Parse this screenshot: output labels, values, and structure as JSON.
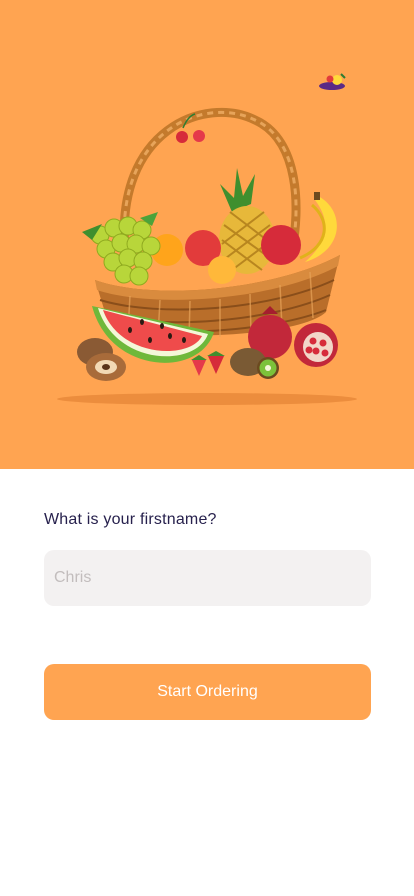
{
  "hero": {
    "image": "fruit-basket-illustration",
    "background_color": "#FFA451",
    "decoration": "small-fruit-icon"
  },
  "form": {
    "question": "What is your firstname?",
    "name_input": {
      "value": "",
      "placeholder": "Chris"
    },
    "submit_label": "Start Ordering"
  },
  "colors": {
    "accent": "#FFA451",
    "input_bg": "#F3F1F1",
    "text": "#27214D",
    "placeholder": "#C2BDBD"
  }
}
